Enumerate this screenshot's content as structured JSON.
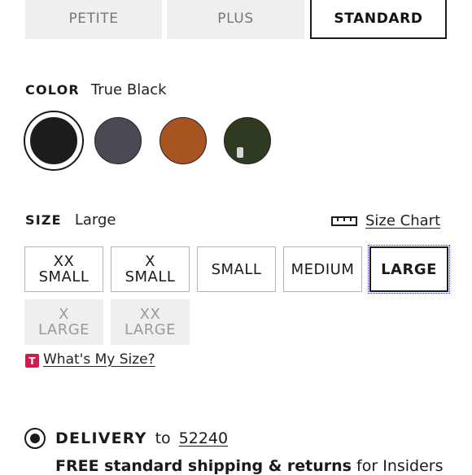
{
  "fit_tabs": [
    {
      "label": "PETITE",
      "selected": false
    },
    {
      "label": "PLUS",
      "selected": false
    },
    {
      "label": "STANDARD",
      "selected": true
    }
  ],
  "color": {
    "label": "COLOR",
    "selected_value": "True Black",
    "swatches": [
      {
        "name": "True Black",
        "hex": "#1c1c1c",
        "selected": true
      },
      {
        "name": "Charcoal",
        "hex": "#4a4a55",
        "selected": false
      },
      {
        "name": "Cognac",
        "hex": "#a85420",
        "selected": false
      },
      {
        "name": "Olive",
        "hex": "#2e3a22",
        "selected": false
      }
    ]
  },
  "size": {
    "label": "SIZE",
    "selected_value": "Large",
    "chart_link": "Size Chart",
    "options": [
      {
        "line1": "XX",
        "line2": "SMALL",
        "available": true,
        "selected": false
      },
      {
        "line1": "X",
        "line2": "SMALL",
        "available": true,
        "selected": false
      },
      {
        "line1": "SMALL",
        "line2": "",
        "available": true,
        "selected": false
      },
      {
        "line1": "MEDIUM",
        "line2": "",
        "available": true,
        "selected": false
      },
      {
        "line1": "LARGE",
        "line2": "",
        "available": true,
        "selected": true
      },
      {
        "line1": "X",
        "line2": "LARGE",
        "available": false,
        "selected": false
      },
      {
        "line1": "XX",
        "line2": "LARGE",
        "available": false,
        "selected": false
      }
    ],
    "whats_my_size": "What's My Size?",
    "badge_letter": "T"
  },
  "delivery": {
    "label": "DELIVERY",
    "to_text": "to",
    "zip": "52240",
    "shipping_bold": "FREE standard shipping & returns",
    "shipping_rest": "for Insiders"
  }
}
